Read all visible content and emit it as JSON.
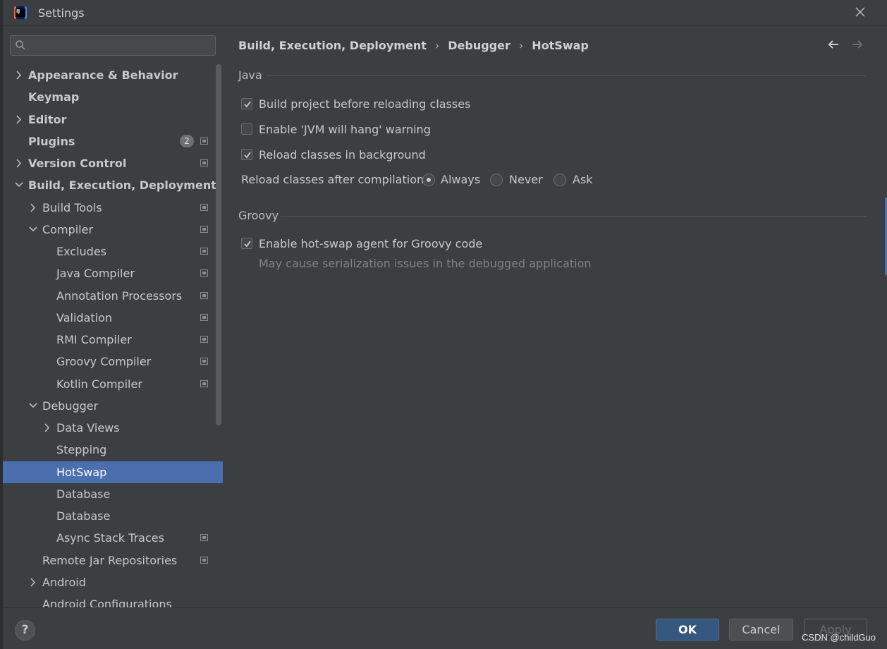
{
  "window": {
    "title": "Settings"
  },
  "search": {
    "placeholder": ""
  },
  "tree": [
    {
      "label": "Appearance & Behavior",
      "level": 0,
      "bold": true,
      "chevron": "right",
      "proj": false
    },
    {
      "label": "Keymap",
      "level": 0,
      "bold": true,
      "chevron": "none",
      "proj": false
    },
    {
      "label": "Editor",
      "level": 0,
      "bold": true,
      "chevron": "right",
      "proj": false
    },
    {
      "label": "Plugins",
      "level": 0,
      "bold": true,
      "chevron": "none",
      "proj": true,
      "badge": "2"
    },
    {
      "label": "Version Control",
      "level": 0,
      "bold": true,
      "chevron": "right",
      "proj": true
    },
    {
      "label": "Build, Execution, Deployment",
      "level": 0,
      "bold": true,
      "chevron": "down",
      "proj": false
    },
    {
      "label": "Build Tools",
      "level": 1,
      "bold": false,
      "chevron": "right",
      "proj": true
    },
    {
      "label": "Compiler",
      "level": 1,
      "bold": false,
      "chevron": "down",
      "proj": true
    },
    {
      "label": "Excludes",
      "level": 2,
      "bold": false,
      "chevron": "none",
      "proj": true
    },
    {
      "label": "Java Compiler",
      "level": 2,
      "bold": false,
      "chevron": "none",
      "proj": true
    },
    {
      "label": "Annotation Processors",
      "level": 2,
      "bold": false,
      "chevron": "none",
      "proj": true
    },
    {
      "label": "Validation",
      "level": 2,
      "bold": false,
      "chevron": "none",
      "proj": true
    },
    {
      "label": "RMI Compiler",
      "level": 2,
      "bold": false,
      "chevron": "none",
      "proj": true
    },
    {
      "label": "Groovy Compiler",
      "level": 2,
      "bold": false,
      "chevron": "none",
      "proj": true
    },
    {
      "label": "Kotlin Compiler",
      "level": 2,
      "bold": false,
      "chevron": "none",
      "proj": true
    },
    {
      "label": "Debugger",
      "level": 1,
      "bold": false,
      "chevron": "down",
      "proj": false
    },
    {
      "label": "Data Views",
      "level": 2,
      "bold": false,
      "chevron": "right",
      "proj": false
    },
    {
      "label": "Stepping",
      "level": 2,
      "bold": false,
      "chevron": "none",
      "proj": false
    },
    {
      "label": "HotSwap",
      "level": 2,
      "bold": false,
      "chevron": "none",
      "proj": false,
      "selected": true
    },
    {
      "label": "Database",
      "level": 2,
      "bold": false,
      "chevron": "none",
      "proj": false
    },
    {
      "label": "Database",
      "level": 2,
      "bold": false,
      "chevron": "none",
      "proj": false
    },
    {
      "label": "Async Stack Traces",
      "level": 2,
      "bold": false,
      "chevron": "none",
      "proj": true
    },
    {
      "label": "Remote Jar Repositories",
      "level": 1,
      "bold": false,
      "chevron": "none",
      "proj": true
    },
    {
      "label": "Android",
      "level": 1,
      "bold": false,
      "chevron": "right",
      "proj": false
    },
    {
      "label": "Android Configurations",
      "level": 1,
      "bold": false,
      "chevron": "none",
      "proj": false
    }
  ],
  "breadcrumb": [
    "Build, Execution, Deployment",
    "Debugger",
    "HotSwap"
  ],
  "nav": {
    "back": "back-arrow-icon",
    "forward": "forward-arrow-icon"
  },
  "java": {
    "title": "Java",
    "build_project": {
      "label": "Build project before reloading classes",
      "checked": true
    },
    "jvm_hang": {
      "label": "Enable 'JVM will hang' warning",
      "checked": false
    },
    "reload_bg": {
      "label": "Reload classes in background",
      "checked": true
    },
    "reload_after": {
      "label": "Reload classes after compilation:",
      "options": [
        "Always",
        "Never",
        "Ask"
      ],
      "selected": "Always"
    }
  },
  "groovy": {
    "title": "Groovy",
    "hotswap_agent": {
      "label": "Enable hot-swap agent for Groovy code",
      "checked": true
    },
    "hint": "May cause serialization issues in the debugged application"
  },
  "footer": {
    "help": "?",
    "ok": "OK",
    "cancel": "Cancel",
    "apply": "Apply"
  },
  "watermark": "CSDN @childGuo",
  "colors": {
    "background": "#3c3f41",
    "selection": "#4b6eaf",
    "ok_button": "#365880",
    "text": "#bbbbbb"
  }
}
